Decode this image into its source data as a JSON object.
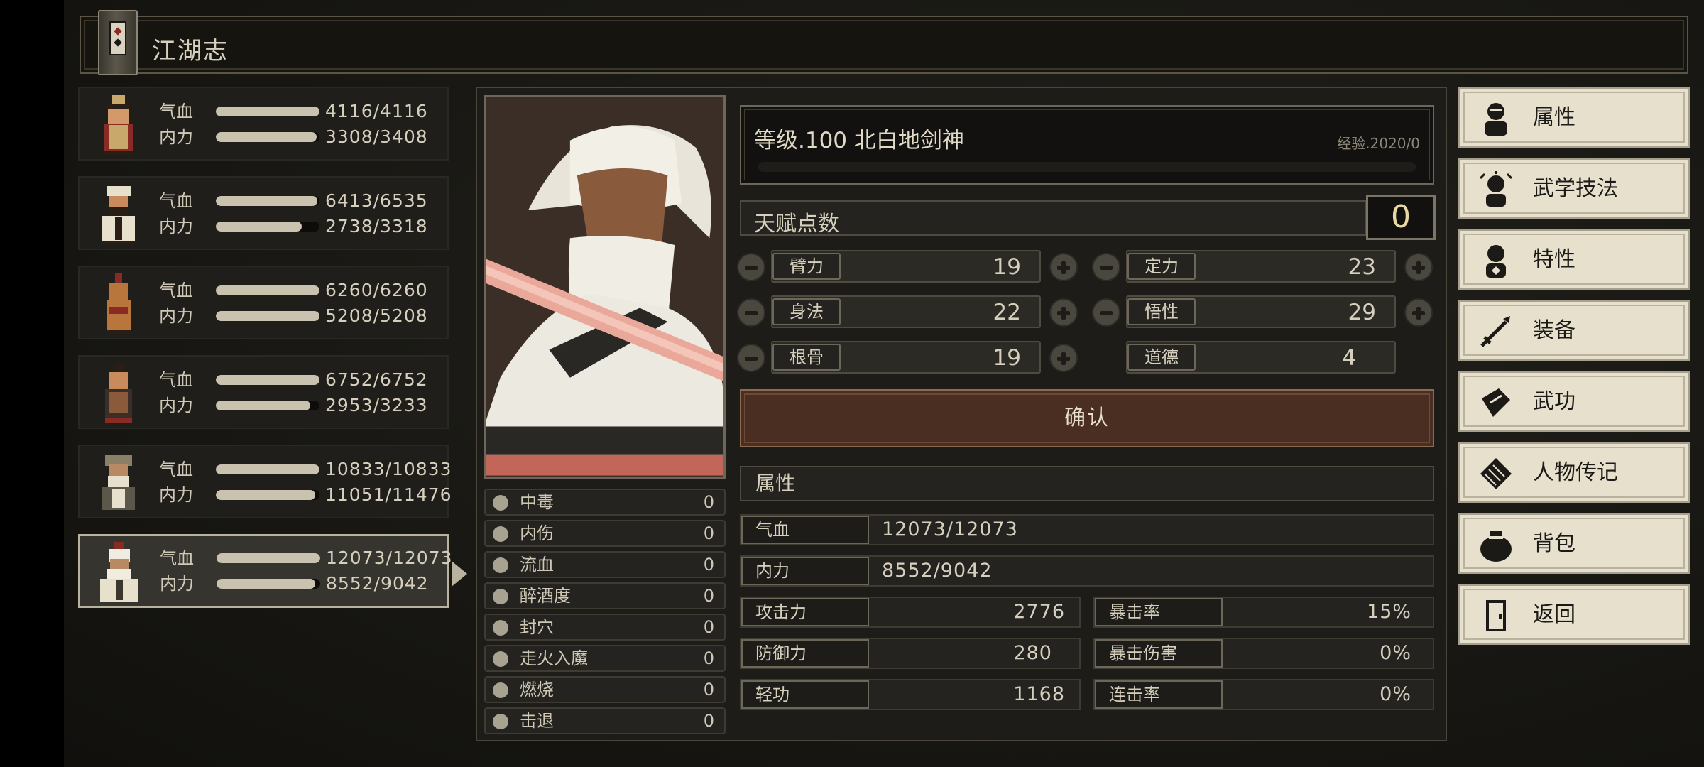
{
  "title": "江湖志",
  "party": [
    {
      "hp": "4116/4116",
      "mp": "3308/3408",
      "hp_frac": 1.0,
      "mp_frac": 0.97
    },
    {
      "hp": "6413/6535",
      "mp": "2738/3318",
      "hp_frac": 0.98,
      "mp_frac": 0.83
    },
    {
      "hp": "6260/6260",
      "mp": "5208/5208",
      "hp_frac": 1.0,
      "mp_frac": 1.0
    },
    {
      "hp": "6752/6752",
      "mp": "2953/3233",
      "hp_frac": 1.0,
      "mp_frac": 0.91
    },
    {
      "hp": "10833/10833",
      "mp": "11051/11476",
      "hp_frac": 1.0,
      "mp_frac": 0.96
    },
    {
      "hp": "12073/12073",
      "mp": "8552/9042",
      "hp_frac": 1.0,
      "mp_frac": 0.95
    }
  ],
  "labels": {
    "hp": "气血",
    "mp": "内力"
  },
  "character": {
    "level_text": "等级.100 北白地剑神",
    "exp_text": "经验.2020/0",
    "talent_label": "天赋点数",
    "talent_points": "0"
  },
  "attributes": {
    "bili": {
      "label": "臂力",
      "value": "19"
    },
    "dingli": {
      "label": "定力",
      "value": "23"
    },
    "shenfa": {
      "label": "身法",
      "value": "22"
    },
    "wuxing": {
      "label": "悟性",
      "value": "29"
    },
    "gengu": {
      "label": "根骨",
      "value": "19"
    },
    "daode": {
      "label": "道德",
      "value": "4"
    }
  },
  "confirm_label": "确认",
  "status_effects": [
    {
      "name": "中毒",
      "value": "0",
      "icon": "skull-icon"
    },
    {
      "name": "内伤",
      "value": "0",
      "icon": "broken-heart-icon"
    },
    {
      "name": "流血",
      "value": "0",
      "icon": "blood-icon"
    },
    {
      "name": "醉酒度",
      "value": "0",
      "icon": "drunk-icon"
    },
    {
      "name": "封穴",
      "value": "0",
      "icon": "acupoint-icon"
    },
    {
      "name": "走火入魔",
      "value": "0",
      "icon": "demon-icon"
    },
    {
      "name": "燃烧",
      "value": "0",
      "icon": "fire-icon"
    },
    {
      "name": "击退",
      "value": "0",
      "icon": "knockback-icon"
    }
  ],
  "stats": {
    "header": "属性",
    "hp": {
      "label": "气血",
      "value": "12073/12073"
    },
    "mp": {
      "label": "内力",
      "value": "8552/9042"
    },
    "attack": {
      "label": "攻击力",
      "value": "2776"
    },
    "crit_rate": {
      "label": "暴击率",
      "value": "15%"
    },
    "defense": {
      "label": "防御力",
      "value": "280"
    },
    "crit_damage": {
      "label": "暴击伤害",
      "value": "0%"
    },
    "qinggong": {
      "label": "轻功",
      "value": "1168"
    },
    "combo_rate": {
      "label": "连击率",
      "value": "0%"
    }
  },
  "menu": [
    {
      "label": "属性",
      "icon": "character-icon"
    },
    {
      "label": "武学技法",
      "icon": "martial-skill-icon"
    },
    {
      "label": "特性",
      "icon": "trait-icon"
    },
    {
      "label": "装备",
      "icon": "sword-icon"
    },
    {
      "label": "武功",
      "icon": "manual-icon"
    },
    {
      "label": "人物传记",
      "icon": "biography-icon"
    },
    {
      "label": "背包",
      "icon": "bag-icon"
    },
    {
      "label": "返回",
      "icon": "door-icon"
    }
  ]
}
